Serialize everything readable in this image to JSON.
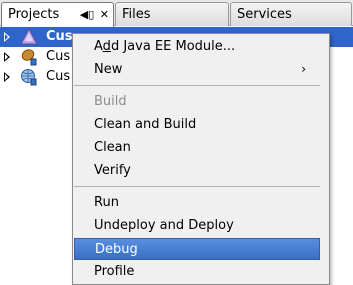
{
  "tabs": [
    {
      "label": "Projects",
      "active": true
    },
    {
      "label": "Files",
      "active": false
    },
    {
      "label": "Services",
      "active": false
    }
  ],
  "tab_controls": {
    "minimize": "◀▯",
    "close": "✕"
  },
  "tree": {
    "rows": [
      {
        "label": "Cus",
        "icon": "enterprise-project-icon",
        "selected": true
      },
      {
        "label": "Cus",
        "icon": "ejb-module-icon",
        "selected": false
      },
      {
        "label": "Cus",
        "icon": "web-module-icon",
        "selected": false
      }
    ]
  },
  "menu": {
    "items": [
      {
        "label": "Add Java EE Module...",
        "mnemonic": "d",
        "enabled": true
      },
      {
        "label": "New",
        "submenu": true,
        "enabled": true
      },
      {
        "separator": true
      },
      {
        "label": "Build",
        "enabled": false
      },
      {
        "label": "Clean and Build",
        "enabled": true
      },
      {
        "label": "Clean",
        "enabled": true
      },
      {
        "label": "Verify",
        "enabled": true
      },
      {
        "separator": true
      },
      {
        "label": "Run",
        "enabled": true
      },
      {
        "label": "Undeploy and Deploy",
        "enabled": true
      },
      {
        "label": "Debug",
        "enabled": true,
        "highlighted": true
      },
      {
        "label": "Profile",
        "enabled": true
      }
    ],
    "submenu_arrow": "›"
  },
  "colors": {
    "selection": "#2f65ca",
    "menu_highlight": "#3b6fc4",
    "menu_background": "#f0f0f0"
  }
}
